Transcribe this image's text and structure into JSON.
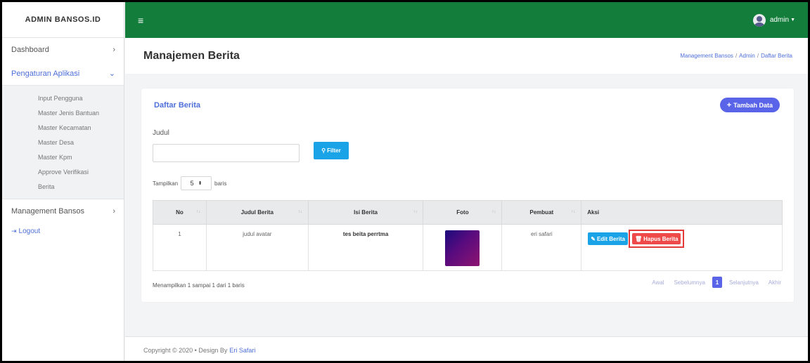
{
  "sidebar": {
    "brand": "ADMIN BANSOS.ID",
    "items": [
      {
        "label": "Dashboard"
      },
      {
        "label": "Pengaturan Aplikasi"
      },
      {
        "label": "Management Bansos"
      }
    ],
    "submenu": [
      {
        "label": "Input Pengguna"
      },
      {
        "label": "Master Jenis Bantuan"
      },
      {
        "label": "Master Kecamatan"
      },
      {
        "label": "Master Desa"
      },
      {
        "label": "Master Kpm"
      },
      {
        "label": "Approve Verifikasi"
      },
      {
        "label": "Berita"
      }
    ],
    "logout": "Logout"
  },
  "topbar": {
    "user": "admin",
    "color": "#137d3b"
  },
  "header": {
    "title": "Manajemen Berita",
    "breadcrumb": [
      "Management Bansos",
      "Admin",
      "Daftar Berita"
    ]
  },
  "card": {
    "title": "Daftar Berita",
    "add_label": "Tambah Data",
    "filter_label": "Judul",
    "filter_value": "",
    "filter_button": "Filter",
    "show_prefix": "Tampilkan",
    "show_value": "5",
    "show_suffix": "baris"
  },
  "table": {
    "columns": [
      "No",
      "Judul Berita",
      "Isi Berita",
      "Foto",
      "Pembuat",
      "Aksi"
    ],
    "rows": [
      {
        "no": "1",
        "judul": "judul avatar",
        "isi": "tes beita perrtma",
        "pembuat": "eri safari",
        "edit": "Edit Berita",
        "hapus": "Hapus Berita"
      }
    ]
  },
  "pagination": {
    "info": "Menampilkan 1 sampai 1 dari 1 baris",
    "first": "Awal",
    "prev": "Sebelumnya",
    "current": "1",
    "next": "Selanjutnya",
    "last": "Akhir",
    "accent": "#5a64e8"
  },
  "footer": {
    "text": "Copyright © 2020 • Design By",
    "author": "Eri Safari"
  }
}
